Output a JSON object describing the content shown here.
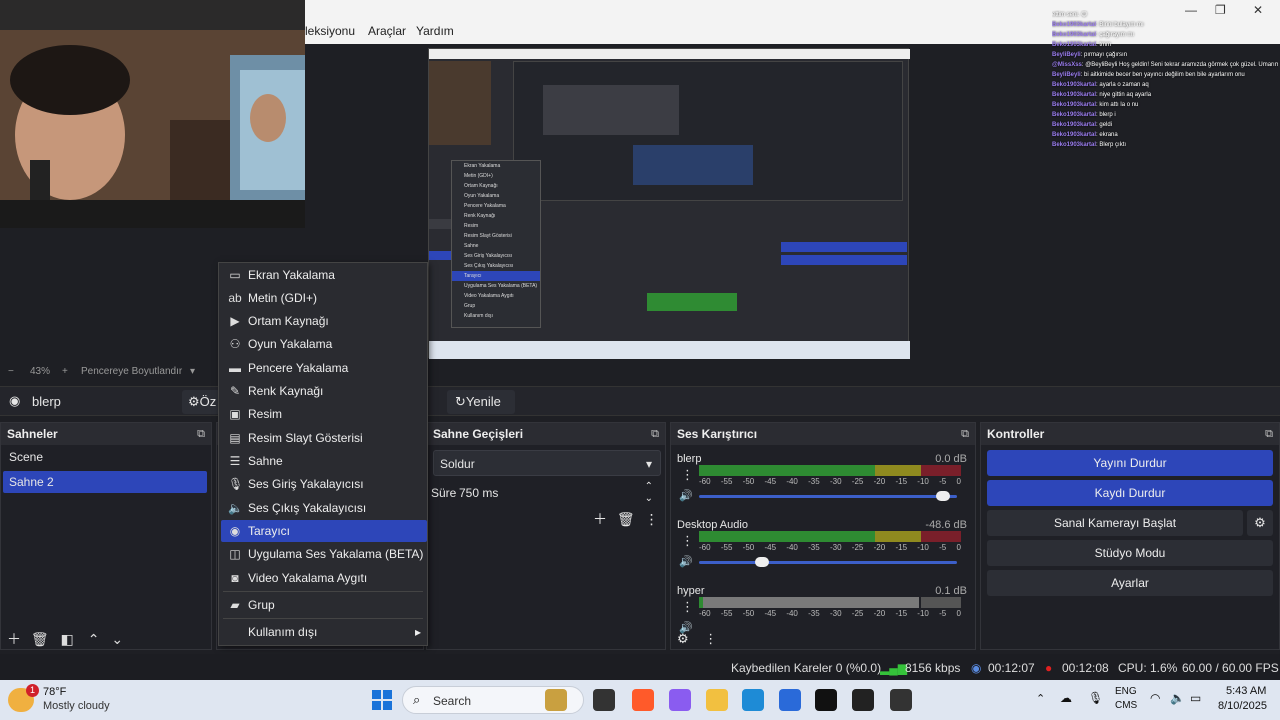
{
  "menubar": {
    "items": [
      "leksiyonu",
      "Araçlar",
      "Yardım"
    ]
  },
  "chat": {
    "lines": [
      {
        "user": "",
        "text": "ettim seni. 😊"
      },
      {
        "user": "Beko1903kartal",
        "text": ": Birini bulayım mı"
      },
      {
        "user": "Beko1903kartal",
        "text": ": çağırayım mı"
      },
      {
        "user": "Beko1903kartal",
        "text": ": tmm"
      },
      {
        "user": "BeyliBeyli",
        "text": ": pırmayı çağırsın"
      },
      {
        "user": "@MissXss",
        "text": ": @BeyliBeyli Hoş geldin! Seni tekrar aramızda görmek çok güzel. Umarım her şey yolundadır. 😊"
      },
      {
        "user": "BeyliBeyli",
        "text": ": bi aitkimide becer ben yayıncı değilim ben bile ayarlarım onu"
      },
      {
        "user": "Beko1903kartal",
        "text": ": ayarla o zaman aq"
      },
      {
        "user": "Beko1903kartal",
        "text": ": niye gittin aq ayarla"
      },
      {
        "user": "Beko1903kartal",
        "text": ": kim attı la o nu"
      },
      {
        "user": "Beko1903kartal",
        "text": ": blerp i"
      },
      {
        "user": "Beko1903kartal",
        "text": ": geldi"
      },
      {
        "user": "Beko1903kartal",
        "text": ": ekrana"
      },
      {
        "user": "Beko1903kartal",
        "text": ": Blerp çıktı"
      }
    ]
  },
  "nested_menu": {
    "items": [
      "Ekran Yakalama",
      "Metin (GDI+)",
      "Ortam Kaynağı",
      "Oyun Yakalama",
      "Pencere Yakalama",
      "Renk Kaynağı",
      "Resim",
      "Resim Slayt Gösterisi",
      "Sahne",
      "Ses Giriş Yakalayıcısı",
      "Ses Çıkış Yakalayıcısı",
      "Tarayıcı",
      "Uygulama Ses Yakalama (BETA)",
      "Video Yakalama Aygıtı",
      "Grup",
      "Kullanım dışı"
    ]
  },
  "zoom": {
    "value": "43%",
    "plus": "+",
    "minus": "−",
    "fit_label": "Pencereye Boyutlandır"
  },
  "scenebar": {
    "source_name": "blerp",
    "props_label": "Öz",
    "refresh_label": "Yenile"
  },
  "scenes": {
    "title": "Sahneler",
    "items": [
      "Scene",
      "Sahne 2"
    ],
    "selected": 1
  },
  "transitions": {
    "title": "Sahne Geçişleri",
    "transition": "Soldur",
    "duration_label": "Süre",
    "duration": "750 ms"
  },
  "mixer": {
    "title": "Ses Karıştırıcı",
    "scale": [
      "-60",
      "-55",
      "-50",
      "-45",
      "-40",
      "-35",
      "-30",
      "-25",
      "-20",
      "-15",
      "-10",
      "-5",
      "0"
    ],
    "channels": [
      {
        "name": "blerp",
        "db": "0.0 dB",
        "volume": 0.97
      },
      {
        "name": "Desktop Audio",
        "db": "-48.6 dB",
        "volume": 0.23
      },
      {
        "name": "hyper",
        "db": "0.1 dB",
        "volume": 1.0
      }
    ]
  },
  "controls": {
    "title": "Kontroller",
    "stop_stream": "Yayını Durdur",
    "stop_record": "Kaydı Durdur",
    "virtual_cam": "Sanal Kamerayı Başlat",
    "studio_mode": "Stüdyo Modu",
    "settings": "Ayarlar"
  },
  "context_menu": {
    "items": [
      {
        "label": "Ekran Yakalama",
        "icon": "monitor-icon"
      },
      {
        "label": "Metin (GDI+)",
        "icon": "text-icon"
      },
      {
        "label": "Ortam Kaynağı",
        "icon": "play-icon"
      },
      {
        "label": "Oyun Yakalama",
        "icon": "gamepad-icon"
      },
      {
        "label": "Pencere Yakalama",
        "icon": "window-icon"
      },
      {
        "label": "Renk Kaynağı",
        "icon": "brush-icon"
      },
      {
        "label": "Resim",
        "icon": "image-icon"
      },
      {
        "label": "Resim Slayt Gösterisi",
        "icon": "slideshow-icon"
      },
      {
        "label": "Sahne",
        "icon": "list-icon"
      },
      {
        "label": "Ses Giriş Yakalayıcısı",
        "icon": "microphone-icon"
      },
      {
        "label": "Ses Çıkış Yakalayıcısı",
        "icon": "speaker-icon"
      },
      {
        "label": "Tarayıcı",
        "icon": "globe-icon"
      },
      {
        "label": "Uygulama Ses Yakalama (BETA)",
        "icon": "app-audio-icon"
      },
      {
        "label": "Video Yakalama Aygıtı",
        "icon": "camera-icon"
      },
      {
        "label": "Grup",
        "icon": "folder-icon"
      },
      {
        "label": "Kullanım dışı",
        "icon": ""
      }
    ],
    "highlighted": 11
  },
  "status": {
    "dropped": "Kaybedilen Kareler 0 (%0.0)",
    "bitrate": "8156 kbps",
    "stream_time": "00:12:07",
    "record_time": "00:12:08",
    "cpu": "CPU: 1.6%",
    "fps": "60.00 / 60.00 FPS"
  },
  "taskbar": {
    "weather_temp": "78°F",
    "weather_desc": "Mostly cloudy",
    "weather_badge": "1",
    "search": "Search",
    "lang1": "ENG",
    "lang2": "CMS",
    "time": "5:43 AM",
    "date": "8/10/2025"
  },
  "colors": {
    "accent": "#2d46b9",
    "meter_green": "#2e8b32",
    "meter_yellow": "#8f8a1f",
    "meter_red": "#7a1f2a",
    "record_red": "#e02020"
  }
}
